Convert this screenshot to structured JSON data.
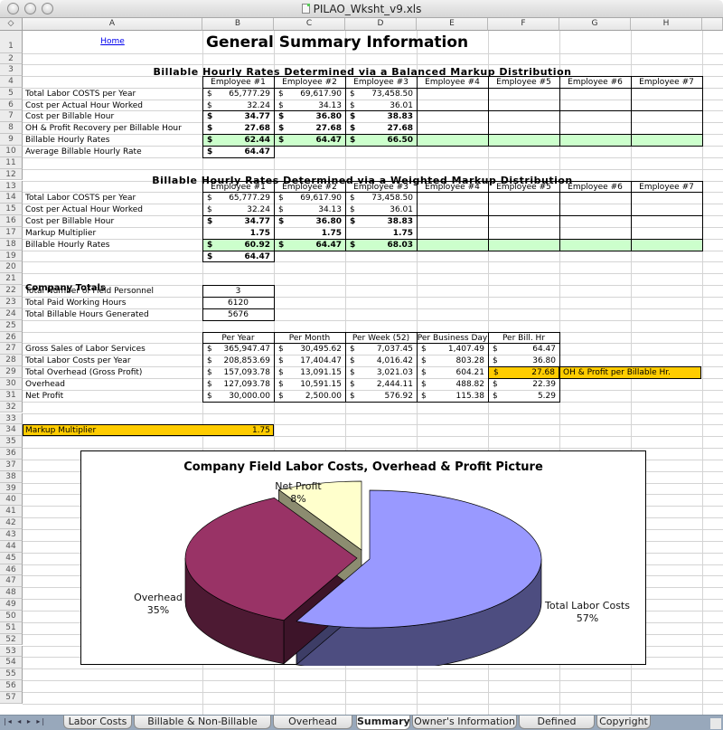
{
  "window": {
    "title": "PILAO_Wksht_v9.xls"
  },
  "columns": [
    "A",
    "B",
    "C",
    "D",
    "E",
    "F",
    "G",
    "H"
  ],
  "rows": [
    "1",
    "2",
    "3",
    "4",
    "5",
    "6",
    "7",
    "8",
    "9",
    "10",
    "11",
    "12",
    "13",
    "14",
    "15",
    "16",
    "17",
    "18",
    "19",
    "20",
    "21",
    "22",
    "23",
    "24",
    "25",
    "26",
    "27",
    "28",
    "29",
    "30",
    "31",
    "32",
    "33",
    "34",
    "35",
    "36",
    "37",
    "38",
    "39",
    "40",
    "41",
    "42",
    "43",
    "44",
    "45",
    "46",
    "47",
    "48",
    "49",
    "50",
    "51",
    "52",
    "53",
    "54",
    "55",
    "56",
    "57"
  ],
  "header": {
    "home_link": "Home",
    "title": "General Summary Information"
  },
  "balanced": {
    "title": "Billable Hourly Rates Determined via a Balanced Markup Distribution",
    "employees": [
      "Employee #1",
      "Employee #2",
      "Employee #3",
      "Employee #4",
      "Employee #5",
      "Employee #6",
      "Employee #7"
    ],
    "rows": [
      {
        "label": "Total Labor COSTS per Year",
        "values": [
          "65,777.29",
          "69,617.90",
          "73,458.50"
        ]
      },
      {
        "label": "Cost per Actual Hour Worked",
        "values": [
          "32.24",
          "34.13",
          "36.01"
        ]
      },
      {
        "label": "Cost per Billable Hour",
        "values": [
          "34.77",
          "36.80",
          "38.83"
        ]
      },
      {
        "label": "OH & Profit Recovery per Billable Hour",
        "values": [
          "27.68",
          "27.68",
          "27.68"
        ]
      },
      {
        "label": "Billable Hourly Rates",
        "values": [
          "62.44",
          "64.47",
          "66.50"
        ]
      }
    ],
    "average_label": "Average Billable Hourly Rate",
    "average_value": "64.47"
  },
  "weighted": {
    "title": "Billable Hourly Rates Determined via a Weighted Markup Distribution",
    "employees": [
      "Employee #1",
      "Employee #2",
      "Employee #3",
      "Employee #4",
      "Employee #5",
      "Employee #6",
      "Employee #7"
    ],
    "rows": [
      {
        "label": "Total Labor COSTS per Year",
        "values": [
          "65,777.29",
          "69,617.90",
          "73,458.50"
        ]
      },
      {
        "label": "Cost per Actual Hour Worked",
        "values": [
          "32.24",
          "34.13",
          "36.01"
        ]
      },
      {
        "label": "Cost per Billable Hour",
        "values": [
          "34.77",
          "36.80",
          "38.83"
        ]
      },
      {
        "label": "Markup Multiplier",
        "values": [
          "1.75",
          "1.75",
          "1.75"
        ]
      },
      {
        "label": "Billable Hourly Rates",
        "values": [
          "60.92",
          "64.47",
          "68.03"
        ]
      }
    ],
    "average_value": "64.47"
  },
  "company": {
    "title": "Company Totals",
    "rows": [
      {
        "label": "Total Number of Field Personnel",
        "value": "3"
      },
      {
        "label": "Total Paid Working Hours",
        "value": "6120"
      },
      {
        "label": "Total Billable Hours Generated",
        "value": "5676"
      }
    ]
  },
  "summary": {
    "headers": [
      "Per Year",
      "Per Month",
      "Per Week (52)",
      "Per Business Day",
      "Per Bill. Hr"
    ],
    "rows": [
      {
        "label": "Gross Sales of Labor Services",
        "values": [
          "365,947.47",
          "30,495.62",
          "7,037.45",
          "1,407.49",
          "64.47"
        ]
      },
      {
        "label": "Total Labor Costs per Year",
        "values": [
          "208,853.69",
          "17,404.47",
          "4,016.42",
          "803.28",
          "36.80"
        ]
      },
      {
        "label": "Total Overhead (Gross Profit)",
        "values": [
          "157,093.78",
          "13,091.15",
          "3,021.03",
          "604.21",
          "27.68"
        ]
      },
      {
        "label": "Overhead",
        "values": [
          "127,093.78",
          "10,591.15",
          "2,444.11",
          "488.82",
          "22.39"
        ]
      },
      {
        "label": "Net Profit",
        "values": [
          "30,000.00",
          "2,500.00",
          "576.92",
          "115.38",
          "5.29"
        ]
      }
    ],
    "note": "OH & Profit per Billable Hr."
  },
  "markup": {
    "label": "Markup Multiplier",
    "value": "1.75"
  },
  "currency_symbol": "$",
  "colors": {
    "green_fill": "#ccffcc",
    "gold_fill": "#ffcc00",
    "link": "#0000ee"
  },
  "chart_data": {
    "type": "pie",
    "title": "Company Field Labor Costs, Overhead & Profit Picture",
    "categories": [
      "Total Labor Costs",
      "Overhead",
      "Net Profit"
    ],
    "values": [
      57,
      35,
      8
    ],
    "value_labels": [
      "57%",
      "35%",
      "8%"
    ],
    "colors": [
      "#9999ff",
      "#993366",
      "#ffffcc"
    ],
    "style": "3d-exploded"
  },
  "tabs": {
    "items": [
      "Labor Costs",
      "Billable & Non-Billable Hours",
      "Overhead Costs",
      "Summary",
      "Owner's Information",
      "Defined Names",
      "Copyright"
    ],
    "active": "Summary"
  }
}
